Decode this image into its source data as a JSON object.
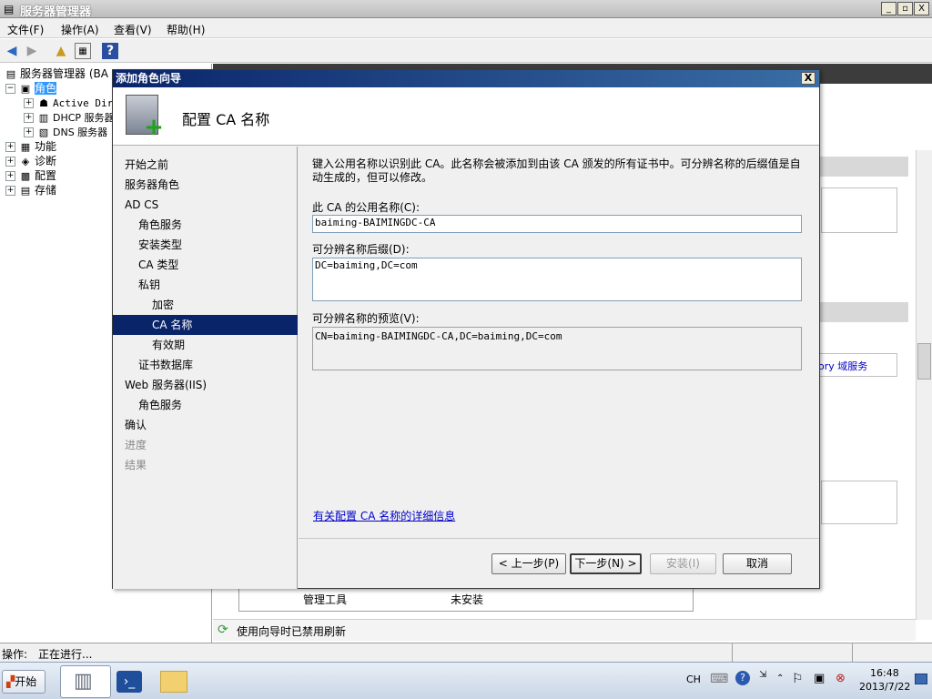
{
  "app": {
    "title": "服务器管理器",
    "window_buttons": [
      "_",
      "▫",
      "X"
    ]
  },
  "menu": [
    "文件(F)",
    "操作(A)",
    "查看(V)",
    "帮助(H)"
  ],
  "tree": {
    "root": "服务器管理器 (BA",
    "roles": "角色",
    "children": [
      "Active Dir",
      "DHCP 服务器",
      "DNS 服务器"
    ],
    "features": "功能",
    "diagnostics": "诊断",
    "configuration": "配置",
    "storage": "存储"
  },
  "right_pane": {
    "link_fragment": "ory 域服务",
    "table_row": {
      "name": "管理工具",
      "status": "未安装"
    },
    "refresh_notice": "使用向导时已禁用刷新"
  },
  "status": {
    "label": "操作:",
    "value": "正在进行..."
  },
  "taskbar": {
    "start": "开始",
    "lang": "CH",
    "time": "16:48",
    "date": "2013/7/22"
  },
  "wizard": {
    "title": "添加角色向导",
    "header_title": "配置 CA 名称",
    "steps": [
      {
        "label": "开始之前",
        "indent": 0,
        "state": "normal"
      },
      {
        "label": "服务器角色",
        "indent": 0,
        "state": "normal"
      },
      {
        "label": "AD CS",
        "indent": 0,
        "state": "normal"
      },
      {
        "label": "角色服务",
        "indent": 1,
        "state": "normal"
      },
      {
        "label": "安装类型",
        "indent": 1,
        "state": "normal"
      },
      {
        "label": "CA 类型",
        "indent": 1,
        "state": "normal"
      },
      {
        "label": "私钥",
        "indent": 1,
        "state": "normal"
      },
      {
        "label": "加密",
        "indent": 2,
        "state": "normal"
      },
      {
        "label": "CA 名称",
        "indent": 2,
        "state": "active"
      },
      {
        "label": "有效期",
        "indent": 2,
        "state": "normal"
      },
      {
        "label": "证书数据库",
        "indent": 1,
        "state": "normal"
      },
      {
        "label": "Web 服务器(IIS)",
        "indent": 0,
        "state": "normal"
      },
      {
        "label": "角色服务",
        "indent": 1,
        "state": "normal"
      },
      {
        "label": "确认",
        "indent": 0,
        "state": "normal"
      },
      {
        "label": "进度",
        "indent": 0,
        "state": "disabled"
      },
      {
        "label": "结果",
        "indent": 0,
        "state": "disabled"
      }
    ],
    "intro": "键入公用名称以识别此 CA。此名称会被添加到由该 CA 颁发的所有证书中。可分辨名称的后缀值是自动生成的，但可以修改。",
    "common_name_label": "此 CA 的公用名称(C):",
    "common_name_value": "baiming-BAIMINGDC-CA",
    "suffix_label": "可分辨名称后缀(D):",
    "suffix_value": "DC=baiming,DC=com",
    "preview_label": "可分辨名称的预览(V):",
    "preview_value": "CN=baiming-BAIMINGDC-CA,DC=baiming,DC=com",
    "more_info_link": "有关配置 CA 名称的详细信息",
    "buttons": {
      "back": "< 上一步(P)",
      "next": "下一步(N) >",
      "install": "安装(I)",
      "cancel": "取消"
    },
    "close": "X"
  }
}
